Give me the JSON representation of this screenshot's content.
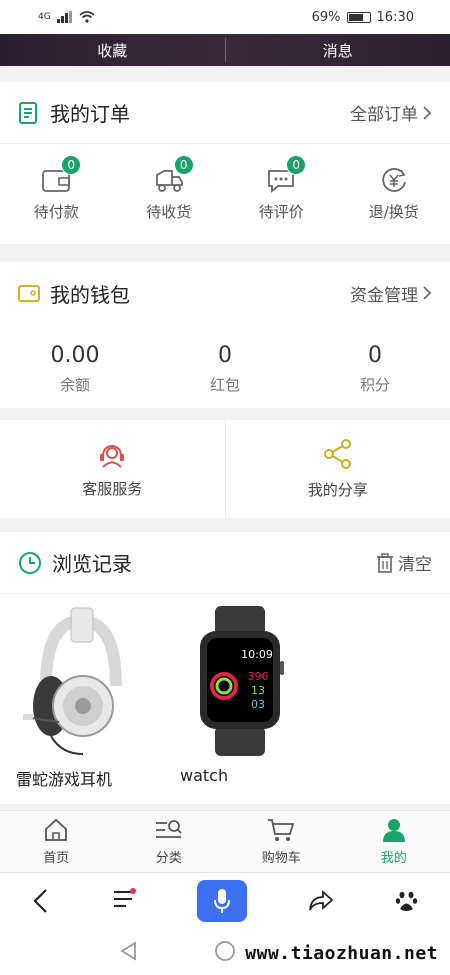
{
  "status": {
    "network": "4G",
    "battery": "69%",
    "time": "16:30"
  },
  "top_tabs": [
    "收藏",
    "消息"
  ],
  "orders": {
    "title": "我的订单",
    "link": "全部订单",
    "items": [
      {
        "label": "待付款",
        "badge": "0",
        "icon": "wallet-icon"
      },
      {
        "label": "待收货",
        "badge": "0",
        "icon": "truck-icon"
      },
      {
        "label": "待评价",
        "badge": "0",
        "icon": "comment-icon"
      },
      {
        "label": "退/换货",
        "icon": "refund-icon"
      }
    ]
  },
  "wallet": {
    "title": "我的钱包",
    "link": "资金管理",
    "items": [
      {
        "value": "0.00",
        "label": "余额"
      },
      {
        "value": "0",
        "label": "红包"
      },
      {
        "value": "0",
        "label": "积分"
      }
    ]
  },
  "services": {
    "customer_service": "客服服务",
    "share": "我的分享"
  },
  "history": {
    "title": "浏览记录",
    "clear": "清空",
    "items": [
      {
        "name": "雷蛇游戏耳机",
        "image": "headphones-image"
      },
      {
        "name": "watch",
        "image": "watch-image",
        "screen_time": "10:09",
        "screen_values": [
          "396",
          "13",
          "03"
        ]
      }
    ]
  },
  "bottom_nav": [
    {
      "label": "首页",
      "icon": "home-icon"
    },
    {
      "label": "分类",
      "icon": "category-icon"
    },
    {
      "label": "购物车",
      "icon": "cart-icon"
    },
    {
      "label": "我的",
      "icon": "person-icon",
      "active": true
    }
  ],
  "watermark": "www.tiaozhuan.net",
  "colors": {
    "accent": "#1aa36b",
    "mic": "#3d6ff2",
    "service_icon": "#d9534f",
    "share_icon": "#c9b020"
  }
}
